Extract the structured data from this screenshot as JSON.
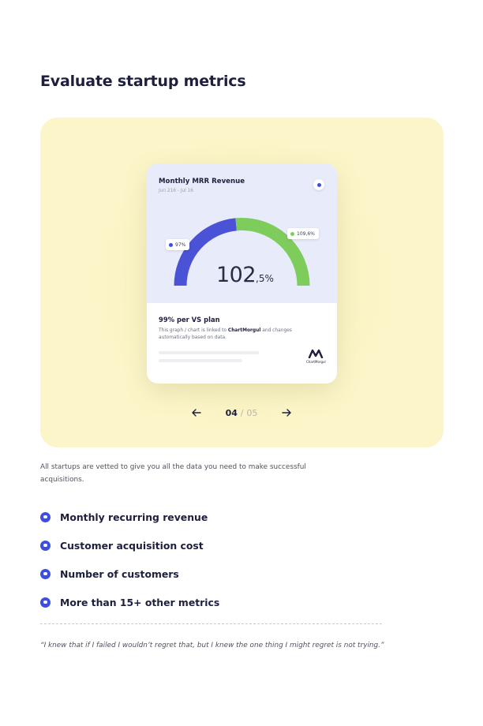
{
  "section": {
    "title": "Evaluate startup metrics"
  },
  "card": {
    "title": "Monthly MRR Revenue",
    "date_range": "Jun 216 - Jul 16",
    "gauge": {
      "left_label": "97%",
      "right_label": "109,6%",
      "value_int": "102",
      "value_dec": ",5%",
      "left_color": "#4a52d6",
      "right_color": "#7ecd5c",
      "left_fraction": 0.47
    },
    "subtitle": "99% per VS plan",
    "desc_prefix": "This graph / chart is linked to ",
    "desc_brand": "ChartMorgul",
    "desc_suffix": " and changes automatically based on data.",
    "brand_name": "ChartMorgul"
  },
  "pager": {
    "current": "04",
    "separator": "/",
    "total": "05"
  },
  "intro": "All startups are vetted to give you all the data you need to make successful acquisitions.",
  "features": [
    {
      "label": "Monthly recurring revenue"
    },
    {
      "label": "Customer acquisition cost"
    },
    {
      "label": "Number of customers"
    },
    {
      "label": "More than 15+ other metrics"
    }
  ],
  "quote": "“I knew that if I failed I wouldn’t regret that, but I knew the one thing I might regret is not trying.”",
  "colors": {
    "accent": "#3e4fe0",
    "hero_bg": "#fbf5c9",
    "card_top_bg": "#e8ecfa"
  }
}
